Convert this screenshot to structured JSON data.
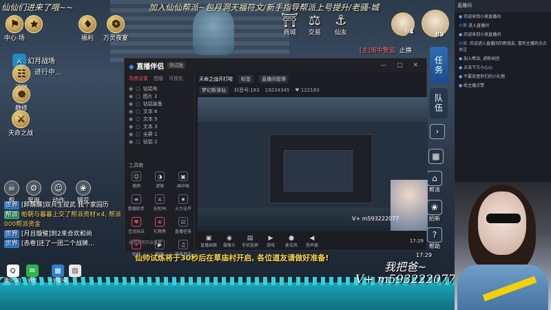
{
  "banner": {
    "line1": "仙仙们进来了哦~~",
    "line2": "加入仙仙帮派~包月洞天福符文/新手指导帮派上号提升/老骚-城"
  },
  "top_left_icons": [
    {
      "label": "中心·场",
      "icon": "⚑"
    },
    {
      "label": "",
      "icon": "★"
    },
    {
      "label": "福利",
      "icon": "♦"
    },
    {
      "label": "万灵夜宴",
      "icon": "❂"
    }
  ],
  "event": {
    "badge": "⚔",
    "title": "幻月战场",
    "status": "进行中..."
  },
  "left_menu": [
    {
      "label": "活动",
      "icon": "☷"
    },
    {
      "label": "静修",
      "icon": "☸"
    },
    {
      "label": "天命之战",
      "icon": "⚔"
    }
  ],
  "top_right_menu": [
    {
      "label": "商城",
      "icon": "⛩"
    },
    {
      "label": "交易",
      "icon": "⚖"
    },
    {
      "label": "仙友",
      "icon": "⚓"
    }
  ],
  "levels": {
    "pet": "94",
    "player": "89"
  },
  "side_tabs": [
    "任务",
    "队伍"
  ],
  "quest_hint": "[主]雨中警监",
  "quest_hint2": "止换",
  "right_controls": [
    {
      "label": "帮派",
      "icon": "⌂"
    },
    {
      "label": "招新",
      "icon": "❀"
    },
    {
      "label": "帮助",
      "icon": "?"
    }
  ],
  "actions": [
    {
      "label": "帮",
      "icon": "☠"
    },
    {
      "label": "常用",
      "icon": "⚙"
    },
    {
      "label": "动作",
      "icon": "☺"
    },
    {
      "label": "钢花",
      "icon": "❀"
    }
  ],
  "chat": [
    {
      "tag": "世界",
      "text": "[醉醺醺]双兵生提武 我个家园历"
    },
    {
      "tag": "帮派",
      "text": "帕朝与暮暮上交了帮派资材×4, 帮派"
    },
    {
      "tag": "",
      "text": "000帮派资金"
    },
    {
      "tag": "世界",
      "text": "[月且璇璧]到2来合欢和尚"
    },
    {
      "tag": "世界",
      "text": "[赤卷]还了一团二个战狮…"
    }
  ],
  "notice": "仙帅试炼将于30秒后在草庙村开启, 各位道友请做好准备!",
  "desktop_icons": [
    {
      "label": "腾讯QQ",
      "icon": "Q",
      "color": "#111"
    },
    {
      "label": "微信",
      "icon": "✉",
      "color": "#2bb24c"
    },
    {
      "label": "一键卸载",
      "icon": "▦",
      "color": "#2e7dd1"
    },
    {
      "label": "",
      "icon": "▧",
      "color": "#e7e7e7"
    }
  ],
  "signature": {
    "line1": "我把爸~",
    "line2": "V+ m593222077"
  },
  "clock": "17:29",
  "app": {
    "name": "直播伴侣",
    "version": "测试版",
    "window_controls": "— □ ✕",
    "tabs": [
      "场景设置",
      "图层",
      "可视化"
    ],
    "layers": [
      "钻铝布",
      "图片 2",
      "钻铝装备",
      "文本 6",
      "文本 5",
      "文本 3",
      "全屏 1",
      "钻铝 2"
    ],
    "tools_header": "工具箱",
    "tools": [
      [
        {
          "label": "美颜",
          "icon": "☺"
        },
        {
          "label": "滤镜",
          "icon": "◑"
        },
        {
          "label": "画中画",
          "icon": "▣"
        }
      ],
      [
        {
          "label": "数据助手",
          "icon": "≡"
        },
        {
          "label": "全民PK",
          "icon": "⚔"
        },
        {
          "label": "火力全开",
          "icon": "★"
        }
      ],
      [
        {
          "label": "互动玩法",
          "icon": "♥"
        },
        {
          "label": "礼物秀",
          "icon": "❀"
        },
        {
          "label": "直播任务",
          "icon": "☑"
        }
      ],
      [
        {
          "label": "贴纸",
          "icon": "✦"
        },
        {
          "label": "回放",
          "icon": "▶"
        },
        {
          "label": "背景音乐",
          "icon": "♫"
        }
      ]
    ],
    "topbar": {
      "title": "天命之战开打啦",
      "pill1": "标签",
      "pill2": "直播间管理",
      "row2_a": "梦幻新诛仙",
      "row2_b": "抖音号:183",
      "row2_c": "19234345",
      "row2_d": "♥ 122183"
    },
    "preview_text": "V+ m593222077",
    "bottom_buttons": [
      {
        "label": "直播画面",
        "icon": "▣"
      },
      {
        "label": "摄像头",
        "icon": "◉"
      },
      {
        "label": "手机投屏",
        "icon": "▤"
      },
      {
        "label": "游戏",
        "icon": "▶"
      },
      {
        "label": "麦克风",
        "icon": "●"
      },
      {
        "label": "扬声器",
        "icon": "◀"
      }
    ],
    "bottom_time": "17:29",
    "footer": "如何使用开启直播"
  },
  "right_panel": {
    "header": "直播间",
    "messages": [
      {
        "name": "●",
        "text": "欢迎来到小美直播间"
      },
      {
        "name": "小美",
        "text": "进入直播间"
      },
      {
        "name": "●",
        "text": "欢迎来到小美直播间"
      },
      {
        "name": "小美:",
        "text": "欢迎进入直播间的新朋友, 喜欢主播的点点关注"
      },
      {
        "name": "●",
        "text": "加入帮派, 进粉丝团"
      },
      {
        "name": "●",
        "text": "点击下方小心心"
      },
      {
        "name": "●",
        "text": "不要吝啬你们的小礼物"
      },
      {
        "name": "●",
        "text": "给主播点赞"
      }
    ]
  }
}
